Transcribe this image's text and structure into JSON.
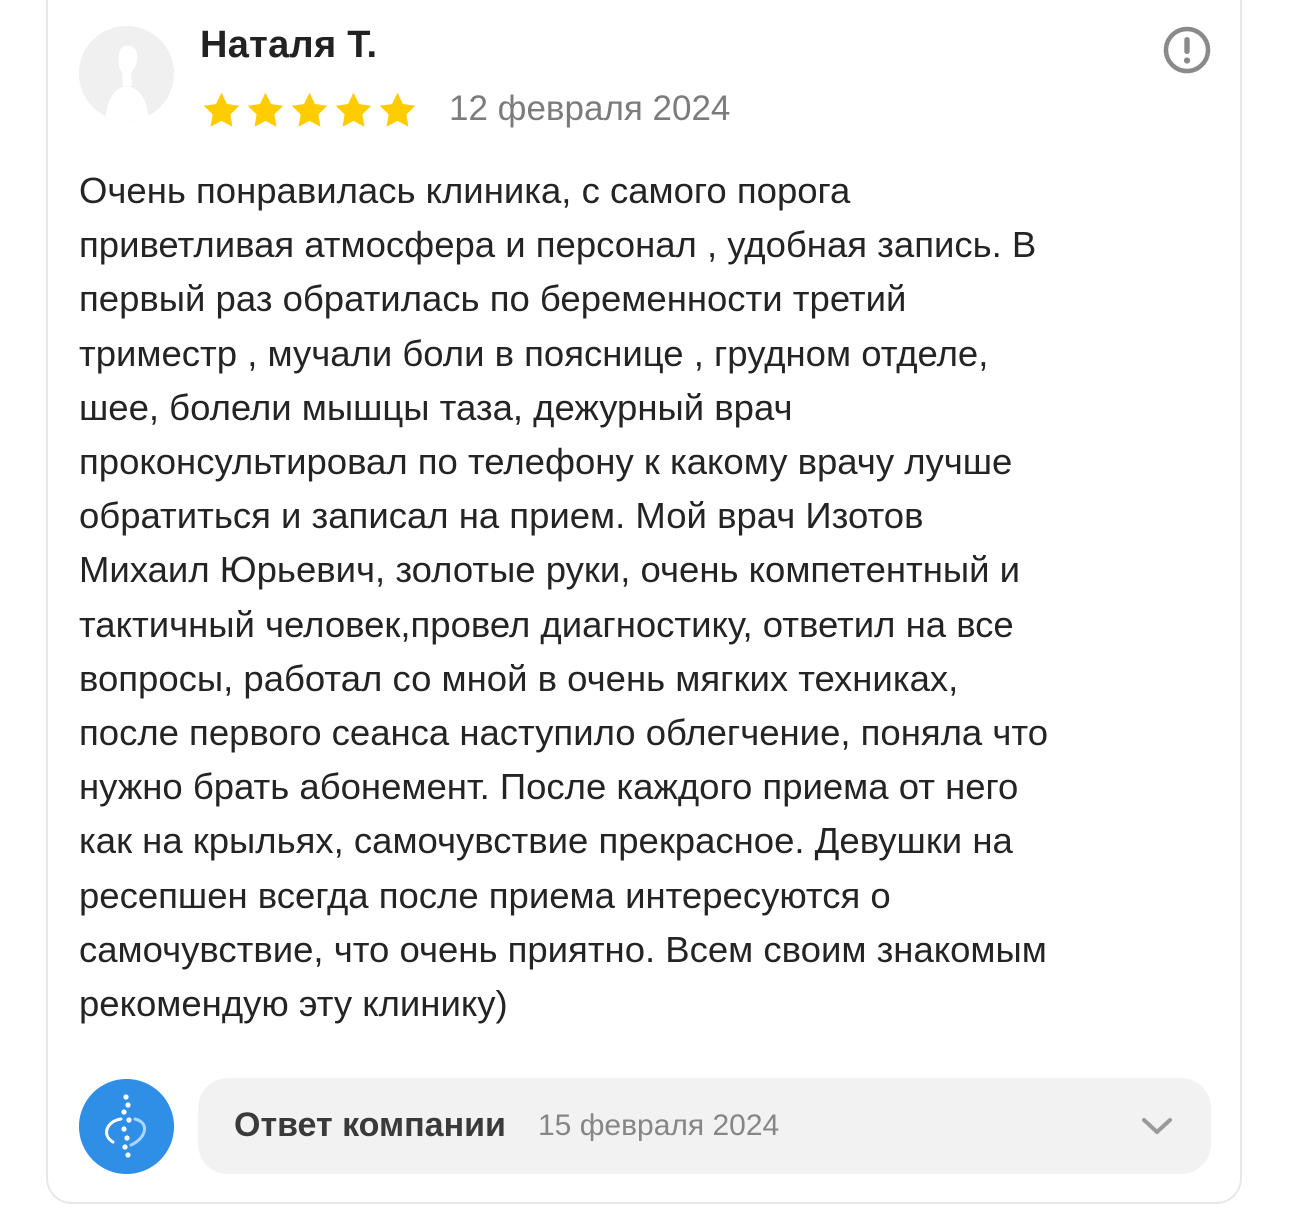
{
  "review": {
    "author": "Наталя Т.",
    "rating": 5,
    "rating_max": 5,
    "date": "12 февраля 2024",
    "text": "Очень понравилась клиника, с самого порога\nприветливая атмосфера и персонал , удобная запись. В\nпервый раз обратилась по беременности третий\nтриместр , мучали боли в пояснице , грудном отделе,\nшее, болели мышцы таза, дежурный врач\nпроконсультировал по телефону к какому врачу лучше\nобратиться и записал на прием. Мой врач Изотов\nМихаил Юрьевич, золотые руки, очень компетентный и\nтактичный человек,провел диагностику, ответил на все\nвопросы, работал со мной в очень мягких техниках,\nпосле первого сеанса наступило облегчение, поняла что\nнужно брать абонемент. После каждого приема от него\nкак на крыльях, самочувствие прекрасное. Девушки на\nресепшен всегда после приема интересуются о\nсамочувствие, что очень приятно. Всем своим знакомым\nрекомендую эту клинику)"
  },
  "company_reply": {
    "label": "Ответ компании",
    "date": "15 февраля 2024"
  },
  "icons": {
    "report": "exclamation-circle-icon",
    "expand": "chevron-down-icon",
    "avatar": "user-silhouette-icon",
    "company_logo": "spine-logo-icon",
    "star": "star-icon"
  },
  "colors": {
    "star": "#ffcc00",
    "company_logo_bg": "#2f8ee6",
    "muted_text": "#7c7c7c",
    "reply_bg": "#f2f2f2"
  }
}
